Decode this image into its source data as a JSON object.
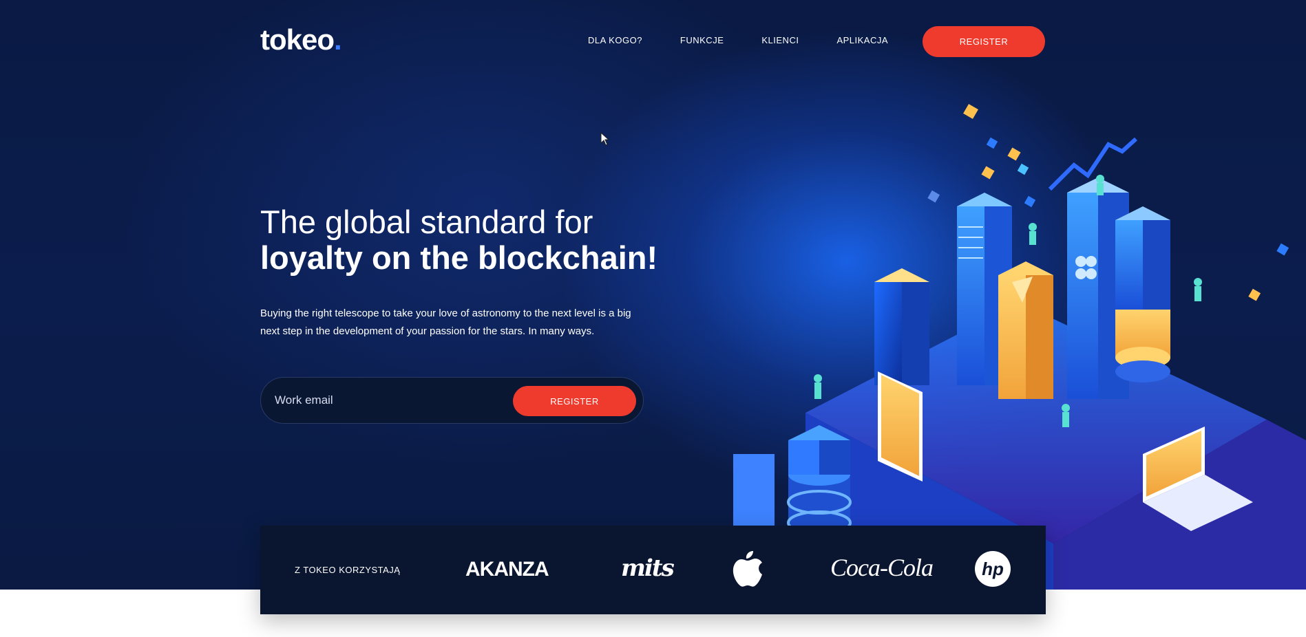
{
  "header": {
    "logo_text": "tokeo",
    "logo_dot": ".",
    "nav": [
      {
        "label": "DLA KOGO?"
      },
      {
        "label": "FUNKCJE"
      },
      {
        "label": "KLIENCI"
      },
      {
        "label": "APLIKACJA"
      }
    ],
    "register_label": "REGISTER"
  },
  "hero": {
    "headline_light": "The global standard for",
    "headline_bold": "loyalty on the blockchain!",
    "lead_line1": "Buying the right telescope to take your love of astronomy to the next level is a big",
    "lead_line2": "next step in the development of your passion for the stars. In many ways.",
    "email_placeholder": "Work email",
    "form_button_label": "REGISTER"
  },
  "clients": {
    "label": "Z TOKEO KORZYSTAJĄ",
    "logos": [
      {
        "name": "AKANZA",
        "icon": "akanza-logo"
      },
      {
        "name": "mits",
        "icon": "mits-logo"
      },
      {
        "name": "Apple",
        "icon": "apple-logo"
      },
      {
        "name": "Coca-Cola",
        "icon": "coca-cola-logo"
      },
      {
        "name": "HP",
        "icon": "hp-logo"
      }
    ]
  },
  "colors": {
    "hero_bg": "#0b1d4d",
    "accent": "#ef3b2d",
    "logo_dot": "#3d7bff",
    "clients_bg": "#0a1530"
  }
}
